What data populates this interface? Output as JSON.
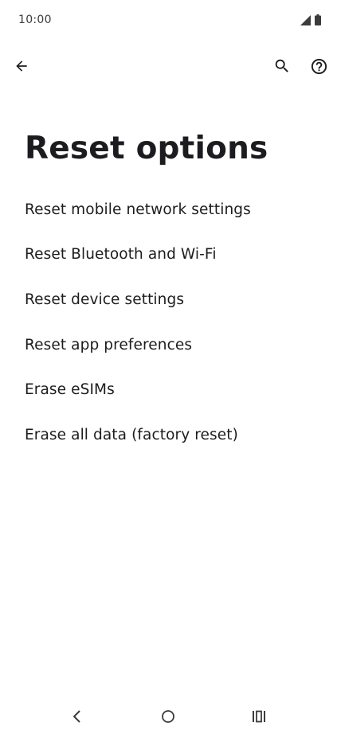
{
  "status_bar": {
    "time": "10:00",
    "icons": [
      "cellular-signal-icon",
      "battery-icon"
    ]
  },
  "app_bar": {
    "icons": [
      "back-arrow-icon",
      "search-icon",
      "help-icon"
    ]
  },
  "page": {
    "title": "Reset options"
  },
  "options": [
    {
      "label": "Reset mobile network settings"
    },
    {
      "label": "Reset Bluetooth and Wi-Fi"
    },
    {
      "label": "Reset device settings"
    },
    {
      "label": "Reset app preferences"
    },
    {
      "label": "Erase eSIMs"
    },
    {
      "label": "Erase all data (factory reset)"
    }
  ],
  "nav_bar": {
    "icons": [
      "nav-back-icon",
      "nav-home-icon",
      "nav-recents-icon"
    ]
  },
  "colors": {
    "text": "#1c1b1f",
    "background": "#ffffff"
  }
}
